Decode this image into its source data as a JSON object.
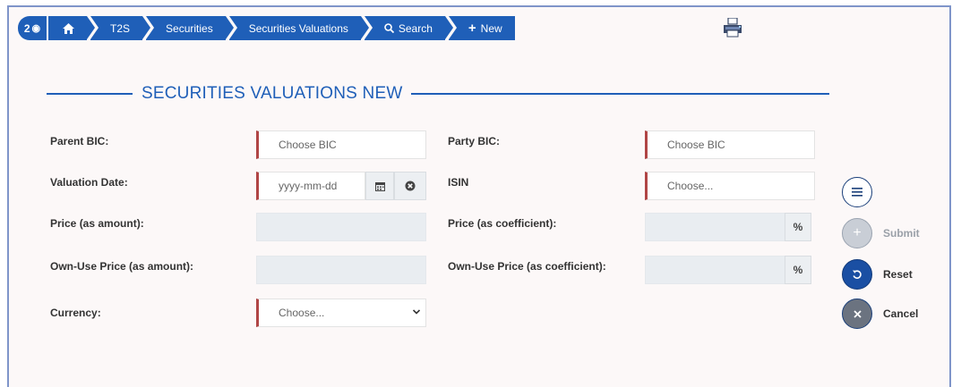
{
  "breadcrumb": {
    "badge_count": "2",
    "items": [
      "T2S",
      "Securities",
      "Securities Valuations",
      "Search",
      "New"
    ]
  },
  "page": {
    "title": "SECURITIES VALUATIONS NEW"
  },
  "form": {
    "parent_bic": {
      "label": "Parent BIC:",
      "placeholder": "Choose BIC"
    },
    "party_bic": {
      "label": "Party BIC:",
      "placeholder": "Choose BIC"
    },
    "valuation_date": {
      "label": "Valuation Date:",
      "placeholder": "yyyy-mm-dd"
    },
    "isin": {
      "label": "ISIN",
      "placeholder": "Choose..."
    },
    "price_amount": {
      "label": "Price (as amount):",
      "value": ""
    },
    "price_coefficient": {
      "label": "Price (as coefficient):",
      "value": "",
      "unit": "%"
    },
    "own_use_price_amount": {
      "label": "Own-Use Price (as amount):",
      "value": ""
    },
    "own_use_price_coefficient": {
      "label": "Own-Use Price (as coefficient):",
      "value": "",
      "unit": "%"
    },
    "currency": {
      "label": "Currency:",
      "selected": "Choose..."
    }
  },
  "actions": {
    "submit": "Submit",
    "reset": "Reset",
    "cancel": "Cancel"
  },
  "colors": {
    "brand_blue": "#1f5fb8",
    "mandatory_red": "#b04545",
    "reset_blue": "#1a4fa3",
    "cancel_gray": "#6b7380",
    "submit_disabled": "#c9ced6"
  },
  "icons": [
    "home-icon",
    "eye-icon",
    "search-icon",
    "plus-icon",
    "printer-icon",
    "calendar-icon",
    "clear-icon",
    "list-icon",
    "undo-icon",
    "close-icon",
    "chevron-down-icon"
  ]
}
